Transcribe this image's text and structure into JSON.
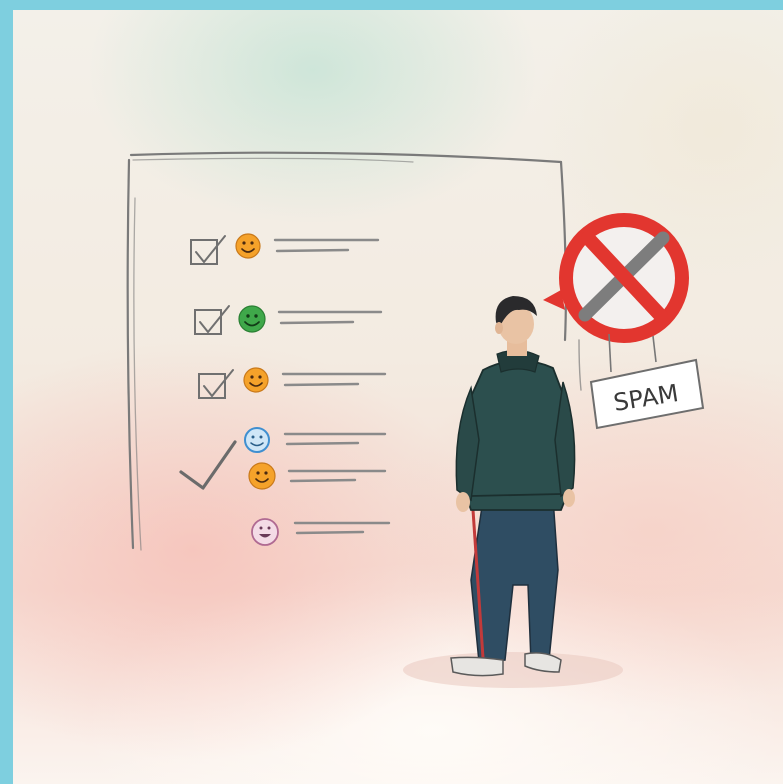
{
  "illustration": {
    "sign_label": "SPAM",
    "colors": {
      "frame": "#7ecfdf",
      "prohibition_red": "#e2362f",
      "jacket": "#2c4f4e",
      "pants": "#2f4d63",
      "stroke": "#6e6e6e"
    },
    "checklist_items": [
      {
        "mark": "checked-box",
        "face": "smiley-orange"
      },
      {
        "mark": "checked-box",
        "face": "smiley-green"
      },
      {
        "mark": "checked-box",
        "face": "smiley-orange"
      },
      {
        "mark": "large-checkmark",
        "face": "smiley-blue"
      },
      {
        "mark": "large-checkmark",
        "face": "smiley-orange"
      },
      {
        "mark": "none",
        "face": "smiley-pink"
      }
    ],
    "icons": [
      "checkbox-icon",
      "smiley-face-icon",
      "checkmark-icon",
      "prohibition-sign-icon",
      "spam-sign"
    ]
  }
}
